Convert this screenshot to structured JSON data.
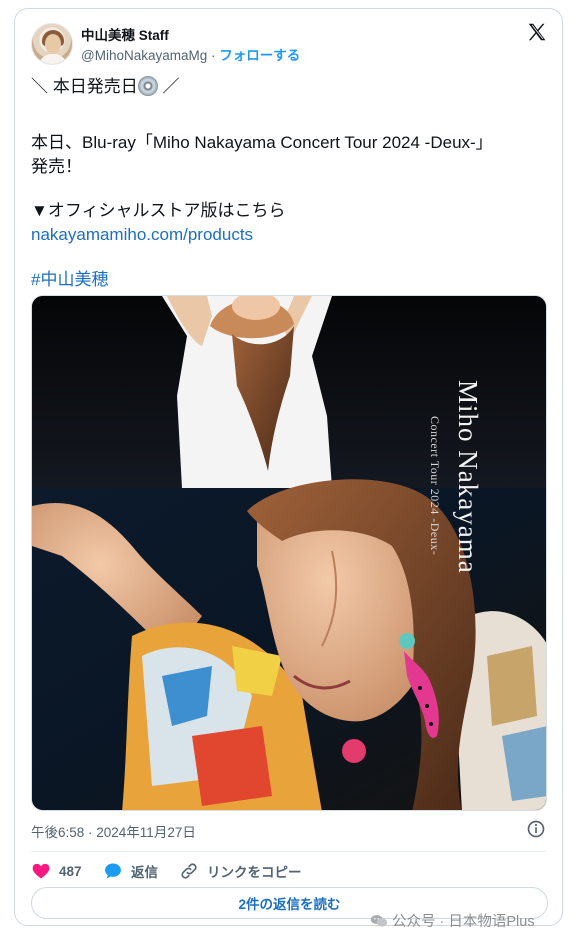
{
  "author": {
    "display_name": "中山美穂 Staff",
    "handle": "@MihoNakayamaMg",
    "separator": " · ",
    "follow_label": "フォローする"
  },
  "post": {
    "line1_a": "＼ 本日発売日",
    "line1_b": " ／",
    "line2": "本日、Blu-ray「Miho Nakayama Concert Tour 2024 -Deux-」",
    "line3": "発売！",
    "line4": "▼オフィシャルストア版はこちら",
    "link": "nakayamamiho.com/products",
    "hashtag": "#中山美穂"
  },
  "media": {
    "cover_title": "Miho Nakayama",
    "cover_subtitle": "Concert Tour 2024 -Deux-"
  },
  "meta": {
    "timestamp": "午後6:58 · 2024年11月27日"
  },
  "actions": {
    "like_count": "487",
    "reply_label": "返信",
    "copy_link_label": "リンクをコピー"
  },
  "replies_button": "2件の返信を読む",
  "watermark": "公众号 · 日本物语Plus",
  "colors": {
    "link": "#1d6fbf",
    "heart": "#f91880",
    "reply_bubble": "#1d9bf0",
    "muted": "#536471"
  },
  "icons": [
    "x-logo-icon",
    "disc-icon",
    "info-icon",
    "heart-icon",
    "reply-bubble-icon",
    "link-icon",
    "wechat-icon"
  ]
}
